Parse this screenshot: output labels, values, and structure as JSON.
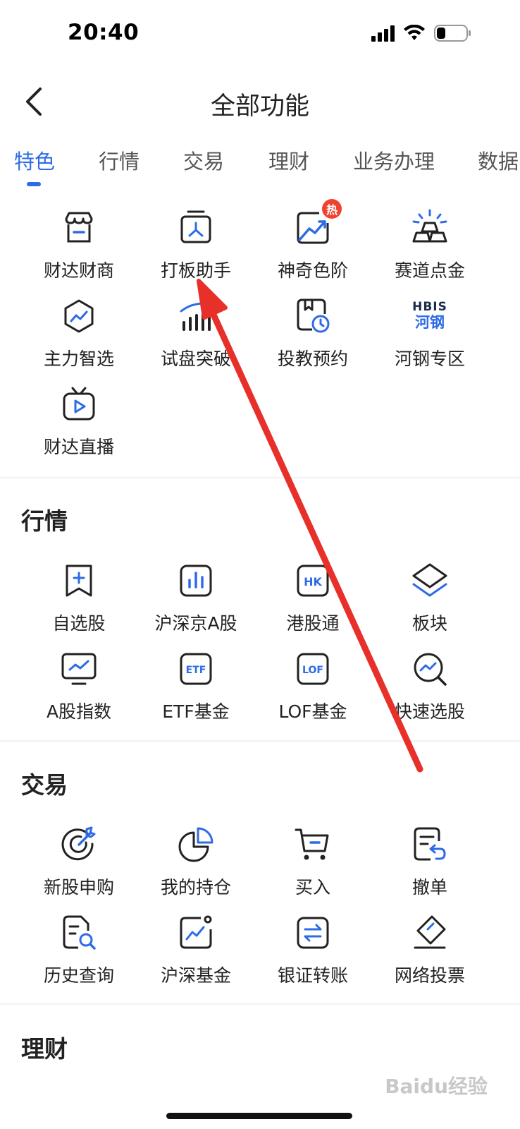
{
  "status_bar": {
    "time": "20:40"
  },
  "nav": {
    "title": "全部功能"
  },
  "tabs": [
    {
      "label": "特色",
      "active": true
    },
    {
      "label": "行情"
    },
    {
      "label": "交易"
    },
    {
      "label": "理财"
    },
    {
      "label": "业务办理"
    },
    {
      "label": "数据"
    }
  ],
  "featured": {
    "items": [
      {
        "label": "财达财商",
        "icon": "shop-icon"
      },
      {
        "label": "打板助手",
        "icon": "board-helper-icon"
      },
      {
        "label": "神奇色阶",
        "icon": "trend-chart-icon",
        "badge": "热"
      },
      {
        "label": "赛道点金",
        "icon": "gold-bar-icon"
      },
      {
        "label": "主力智选",
        "icon": "hexagon-trend-icon"
      },
      {
        "label": "试盘突破",
        "icon": "bar-breakout-icon"
      },
      {
        "label": "投教预约",
        "icon": "book-clock-icon"
      },
      {
        "label": "河钢专区",
        "icon": "hbis-logo-icon",
        "logo_top": "HBIS",
        "logo_bottom": "河钢"
      },
      {
        "label": "财达直播",
        "icon": "tv-play-icon"
      }
    ]
  },
  "market": {
    "title": "行情",
    "items": [
      {
        "label": "自选股",
        "icon": "bookmark-plus-icon"
      },
      {
        "label": "沪深京A股",
        "icon": "bar-chart-icon"
      },
      {
        "label": "港股通",
        "icon": "hk-icon",
        "icon_text": "HK"
      },
      {
        "label": "板块",
        "icon": "layers-icon"
      },
      {
        "label": "A股指数",
        "icon": "monitor-trend-icon"
      },
      {
        "label": "ETF基金",
        "icon": "etf-icon",
        "icon_text": "ETF"
      },
      {
        "label": "LOF基金",
        "icon": "lof-icon",
        "icon_text": "LOF"
      },
      {
        "label": "快速选股",
        "icon": "search-trend-icon"
      }
    ]
  },
  "trade": {
    "title": "交易",
    "items": [
      {
        "label": "新股申购",
        "icon": "target-icon"
      },
      {
        "label": "我的持仓",
        "icon": "pie-chart-icon"
      },
      {
        "label": "买入",
        "icon": "cart-icon"
      },
      {
        "label": "撤单",
        "icon": "doc-undo-icon"
      },
      {
        "label": "历史查询",
        "icon": "doc-search-icon"
      },
      {
        "label": "沪深基金",
        "icon": "chart-dot-icon"
      },
      {
        "label": "银证转账",
        "icon": "transfer-icon"
      },
      {
        "label": "网络投票",
        "icon": "vote-icon"
      }
    ]
  },
  "wealth": {
    "title": "理财"
  },
  "watermark": "Baidu经验",
  "colors": {
    "accent": "#2e6be6",
    "text": "#222222",
    "arrow": "#e8302a",
    "badge": "#f0432f"
  }
}
